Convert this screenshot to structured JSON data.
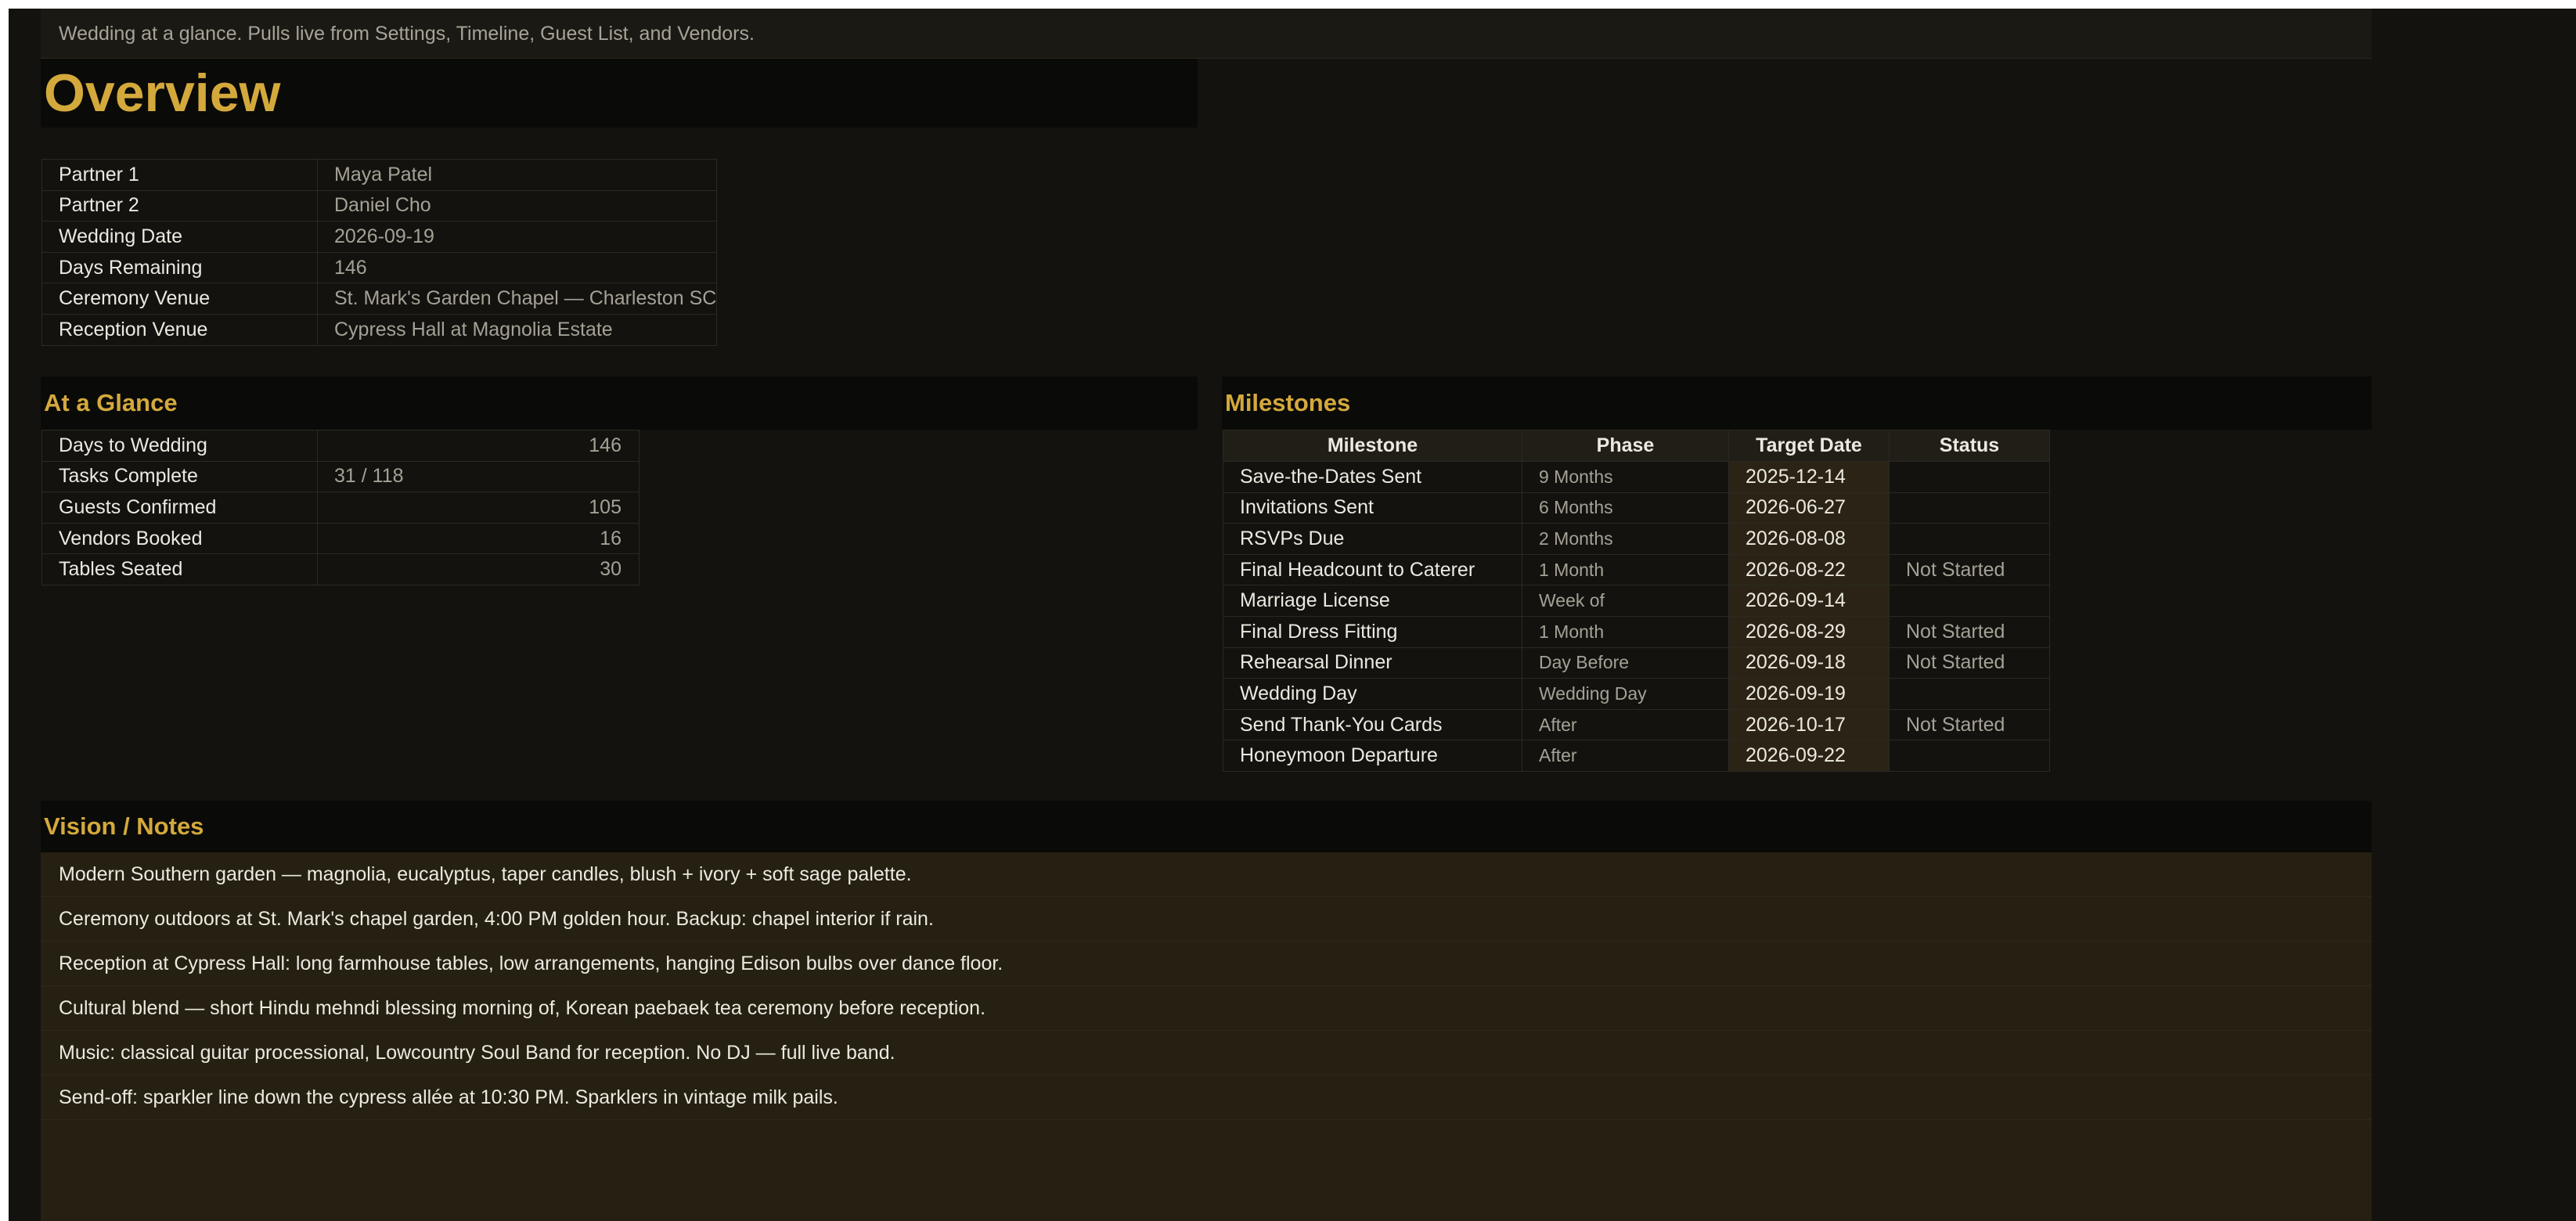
{
  "subtitle": "Wedding at a glance. Pulls live from Settings, Timeline, Guest List, and Vendors.",
  "overview": {
    "title": "Overview",
    "rows": [
      {
        "label": "Partner 1",
        "value": "Maya Patel"
      },
      {
        "label": "Partner 2",
        "value": "Daniel Cho"
      },
      {
        "label": "Wedding Date",
        "value": "2026-09-19"
      },
      {
        "label": "Days Remaining",
        "value": "146"
      },
      {
        "label": "Ceremony Venue",
        "value": "St. Mark's Garden Chapel — Charleston SC"
      },
      {
        "label": "Reception Venue",
        "value": "Cypress Hall at Magnolia Estate"
      }
    ]
  },
  "at_a_glance": {
    "title": "At a Glance",
    "rows": [
      {
        "label": "Days to Wedding",
        "value": "146"
      },
      {
        "label": "Tasks Complete",
        "value": "31 / 118"
      },
      {
        "label": "Guests Confirmed",
        "value": "105"
      },
      {
        "label": "Vendors Booked",
        "value": "16"
      },
      {
        "label": "Tables Seated",
        "value": "30"
      }
    ]
  },
  "milestones": {
    "title": "Milestones",
    "headers": [
      "Milestone",
      "Phase",
      "Target Date",
      "Status"
    ],
    "rows": [
      {
        "milestone": "Save-the-Dates Sent",
        "phase": "9 Months",
        "date": "2025-12-14",
        "status": ""
      },
      {
        "milestone": "Invitations Sent",
        "phase": "6 Months",
        "date": "2026-06-27",
        "status": ""
      },
      {
        "milestone": "RSVPs Due",
        "phase": "2 Months",
        "date": "2026-08-08",
        "status": ""
      },
      {
        "milestone": "Final Headcount to Caterer",
        "phase": "1 Month",
        "date": "2026-08-22",
        "status": "Not Started"
      },
      {
        "milestone": "Marriage License",
        "phase": "Week of",
        "date": "2026-09-14",
        "status": ""
      },
      {
        "milestone": "Final Dress Fitting",
        "phase": "1 Month",
        "date": "2026-08-29",
        "status": "Not Started"
      },
      {
        "milestone": "Rehearsal Dinner",
        "phase": "Day Before",
        "date": "2026-09-18",
        "status": "Not Started"
      },
      {
        "milestone": "Wedding Day",
        "phase": "Wedding Day",
        "date": "2026-09-19",
        "status": ""
      },
      {
        "milestone": "Send Thank-You Cards",
        "phase": "After",
        "date": "2026-10-17",
        "status": "Not Started"
      },
      {
        "milestone": "Honeymoon Departure",
        "phase": "After",
        "date": "2026-09-22",
        "status": ""
      }
    ]
  },
  "notes": {
    "title": "Vision / Notes",
    "lines": [
      "Modern Southern garden — magnolia, eucalyptus, taper candles, blush + ivory + soft sage palette.",
      "Ceremony outdoors at St. Mark's chapel garden, 4:00 PM golden hour. Backup: chapel interior if rain.",
      "Reception at Cypress Hall: long farmhouse tables, low arrangements, hanging Edison bulbs over dance floor.",
      "Cultural blend — short Hindu mehndi blessing morning of, Korean paebaek tea ceremony before reception.",
      "Music: classical guitar processional, Lowcountry Soul Band for reception. No DJ — full live band.",
      "Send-off: sparkler line down the cypress allée at 10:30 PM. Sparklers in vintage milk pails."
    ]
  },
  "colors": {
    "background": "#13120f",
    "accent": "#d4a93c",
    "notes_background": "#262012",
    "date_highlight": "#2b2416"
  }
}
